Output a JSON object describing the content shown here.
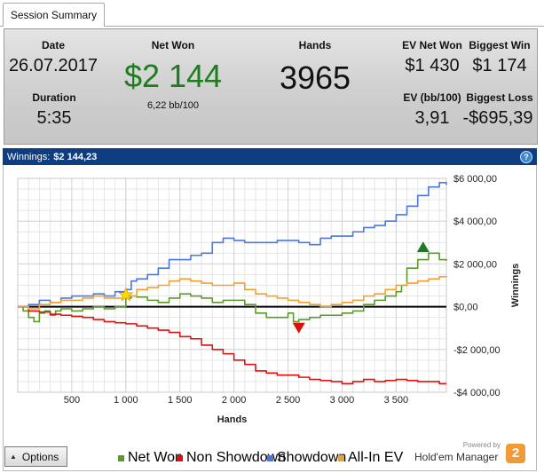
{
  "tab": {
    "label": "Session Summary"
  },
  "summary": {
    "date_label": "Date",
    "date_value": "26.07.2017",
    "duration_label": "Duration",
    "duration_value": "5:35",
    "netwon_label": "Net Won",
    "netwon_value": "$2 144",
    "netwon_bb": "6,22 bb/100",
    "hands_label": "Hands",
    "hands_value": "3965",
    "ev_net_won_label": "EV Net Won",
    "ev_net_won_value": "$1 430",
    "biggest_win_label": "Biggest Win",
    "biggest_win_value": "$1 174",
    "ev_bb_label": "EV (bb/100)",
    "ev_bb_value": "3,91",
    "biggest_loss_label": "Biggest Loss",
    "biggest_loss_value": "-$695,39"
  },
  "winbar": {
    "label": "Winnings:",
    "amount": "$2 144,23",
    "help_icon": "question-icon"
  },
  "options_button": {
    "label": "Options",
    "icon": "arrow-up-icon"
  },
  "brand": {
    "powered": "Powered by",
    "name": "Hold'em Manager",
    "logo": "2",
    "logo_color": "#f19a37"
  },
  "colors": {
    "net_won": "#5a9a2b",
    "non_showdown": "#e01010",
    "showdown": "#4a77e0",
    "allin_ev": "#f0a030"
  },
  "chart_data": {
    "type": "line",
    "xlabel": "Hands",
    "ylabel": "Winnings",
    "xlim": [
      0,
      3965
    ],
    "ylim": [
      -4000,
      6000
    ],
    "x_ticks": [
      "500",
      "1 000",
      "1 500",
      "2 000",
      "2 500",
      "3 000",
      "3 500"
    ],
    "x_tick_values": [
      500,
      1000,
      1500,
      2000,
      2500,
      3000,
      3500
    ],
    "y_ticks": [
      "$6 000,00",
      "$4 000,00",
      "$2 000,00",
      "$0,00",
      "-$2 000,00",
      "-$4 000,00"
    ],
    "y_tick_values": [
      6000,
      4000,
      2000,
      0,
      -2000,
      -4000
    ],
    "grid": true,
    "legend_position": "bottom",
    "series": [
      {
        "name": "Net Won",
        "color": "#5a9a2b",
        "x": [
          0,
          50,
          100,
          150,
          200,
          250,
          300,
          350,
          400,
          500,
          600,
          700,
          800,
          900,
          1000,
          1050,
          1100,
          1200,
          1300,
          1400,
          1500,
          1600,
          1700,
          1800,
          1900,
          2000,
          2100,
          2200,
          2300,
          2400,
          2500,
          2550,
          2600,
          2700,
          2800,
          2900,
          3000,
          3100,
          3200,
          3300,
          3400,
          3500,
          3550,
          3600,
          3700,
          3800,
          3900,
          3965
        ],
        "values": [
          0,
          -200,
          -500,
          -700,
          -300,
          -200,
          -400,
          -200,
          -100,
          -200,
          -100,
          0,
          -100,
          0,
          400,
          500,
          450,
          300,
          200,
          400,
          600,
          500,
          400,
          200,
          300,
          300,
          100,
          -300,
          -500,
          -500,
          -300,
          -700,
          -600,
          -500,
          -400,
          -400,
          -300,
          -200,
          100,
          300,
          500,
          700,
          1000,
          1800,
          2200,
          2500,
          2200,
          2144
        ]
      },
      {
        "name": "Non Showdown",
        "color": "#e01010",
        "x": [
          0,
          100,
          200,
          300,
          400,
          500,
          600,
          700,
          800,
          900,
          1000,
          1100,
          1200,
          1300,
          1400,
          1500,
          1600,
          1700,
          1800,
          1900,
          2000,
          2100,
          2200,
          2300,
          2400,
          2500,
          2600,
          2700,
          2800,
          2900,
          3000,
          3100,
          3200,
          3300,
          3400,
          3500,
          3600,
          3700,
          3800,
          3900,
          3965
        ],
        "values": [
          0,
          -200,
          -250,
          -350,
          -400,
          -450,
          -500,
          -600,
          -700,
          -750,
          -800,
          -900,
          -1000,
          -1100,
          -1200,
          -1400,
          -1500,
          -1800,
          -2000,
          -2200,
          -2500,
          -2700,
          -3000,
          -3100,
          -3200,
          -3200,
          -3300,
          -3400,
          -3450,
          -3500,
          -3600,
          -3500,
          -3400,
          -3500,
          -3450,
          -3400,
          -3450,
          -3500,
          -3500,
          -3600,
          -3600
        ]
      },
      {
        "name": "Showdown",
        "color": "#4a77e0",
        "x": [
          0,
          100,
          200,
          300,
          400,
          500,
          600,
          700,
          800,
          900,
          1000,
          1050,
          1100,
          1200,
          1300,
          1400,
          1500,
          1600,
          1700,
          1800,
          1900,
          2000,
          2100,
          2200,
          2300,
          2400,
          2500,
          2600,
          2700,
          2800,
          2900,
          3000,
          3100,
          3200,
          3300,
          3400,
          3500,
          3600,
          3700,
          3800,
          3900,
          3965
        ],
        "values": [
          0,
          100,
          300,
          200,
          400,
          500,
          500,
          600,
          500,
          700,
          800,
          1200,
          1300,
          1500,
          1800,
          2200,
          2200,
          2400,
          2500,
          3000,
          3200,
          3100,
          3000,
          3000,
          3000,
          3100,
          3100,
          3000,
          2900,
          3200,
          3300,
          3300,
          3500,
          3700,
          3800,
          4000,
          4300,
          4700,
          5200,
          5600,
          5800,
          5700
        ]
      },
      {
        "name": "All-In EV",
        "color": "#f0a030",
        "x": [
          0,
          100,
          200,
          300,
          400,
          500,
          600,
          700,
          800,
          900,
          1000,
          1100,
          1200,
          1300,
          1400,
          1500,
          1600,
          1700,
          1800,
          1900,
          2000,
          2100,
          2200,
          2300,
          2400,
          2500,
          2600,
          2700,
          2800,
          2900,
          3000,
          3100,
          3200,
          3300,
          3400,
          3500,
          3600,
          3700,
          3800,
          3900,
          3965
        ],
        "values": [
          0,
          -100,
          100,
          200,
          300,
          300,
          400,
          500,
          400,
          400,
          500,
          800,
          900,
          1000,
          1200,
          1300,
          1200,
          1100,
          1000,
          1000,
          1100,
          800,
          600,
          500,
          400,
          300,
          200,
          100,
          0,
          100,
          200,
          300,
          500,
          600,
          800,
          1000,
          1100,
          1200,
          1300,
          1400,
          1430
        ]
      }
    ],
    "markers": [
      {
        "type": "star",
        "x": 1000,
        "y": 550,
        "color": "#ffd700"
      },
      {
        "type": "triangle-down",
        "x": 2600,
        "y": -1000,
        "color": "#dd1010"
      },
      {
        "type": "triangle-up",
        "x": 3750,
        "y": 2800,
        "color": "#1f7a1f"
      }
    ]
  }
}
